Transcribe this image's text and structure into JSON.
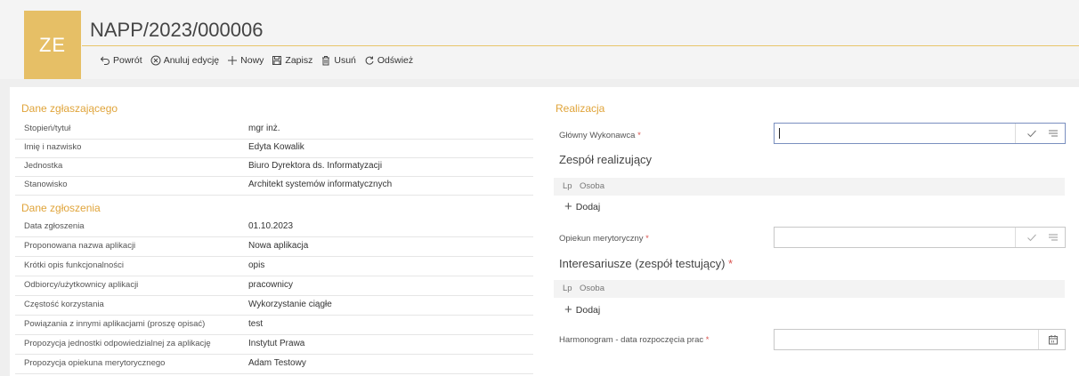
{
  "header": {
    "avatar_initials": "ZE",
    "title": "NAPP/2023/000006"
  },
  "toolbar": {
    "back": "Powrót",
    "cancel_edit": "Anuluj edycję",
    "new": "Nowy",
    "save": "Zapisz",
    "delete": "Usuń",
    "refresh": "Odśwież"
  },
  "left": {
    "section1_title": "Dane zgłaszającego",
    "section1_rows": [
      {
        "label": "Stopień/tytuł",
        "value": "mgr inż."
      },
      {
        "label": "Imię i nazwisko",
        "value": "Edyta Kowalik"
      },
      {
        "label": "Jednostka",
        "value": "Biuro Dyrektora ds. Informatyzacji"
      },
      {
        "label": "Stanowisko",
        "value": "Architekt systemów informatycznych"
      }
    ],
    "section2_title": "Dane zgłoszenia",
    "section2_rows": [
      {
        "label": "Data zgłoszenia",
        "value": "01.10.2023"
      },
      {
        "label": "Proponowana nazwa aplikacji",
        "value": "Nowa aplikacja"
      },
      {
        "label": "Krótki opis funkcjonalności",
        "value": "opis"
      },
      {
        "label": "Odbiorcy/użytkownicy aplikacji",
        "value": "pracownicy"
      },
      {
        "label": "Częstość korzystania",
        "value": "Wykorzystanie ciągłe"
      },
      {
        "label": "Powiązania z innymi aplikacjami (proszę opisać)",
        "value": "test"
      },
      {
        "label": "Propozycja jednostki odpowiedzialnej za aplikację",
        "value": "Instytut Prawa"
      },
      {
        "label": "Propozycja opiekuna merytorycznego",
        "value": "Adam Testowy"
      }
    ]
  },
  "right": {
    "section_title": "Realizacja",
    "main_contractor_label": "Główny Wykonawca",
    "main_contractor_value": "",
    "team_title": "Zespół realizujący",
    "team_col_lp": "Lp",
    "team_col_person": "Osoba",
    "team_add": "Dodaj",
    "supervisor_label": "Opiekun merytoryczny",
    "supervisor_value": "",
    "stakeholders_title": "Interesariusze (zespół testujący)",
    "stakeholders_col_lp": "Lp",
    "stakeholders_col_person": "Osoba",
    "stakeholders_add": "Dodaj",
    "schedule_label": "Harmonogram - data rozpoczęcia prac",
    "schedule_value": "",
    "required_mark": "*"
  },
  "colors": {
    "accent": "#e6bf66",
    "section_heading": "#e0a43a",
    "required": "#d9534f"
  },
  "icons": [
    "back-arrow-icon",
    "cancel-circle-icon",
    "plus-icon",
    "save-disk-icon",
    "trash-icon",
    "refresh-icon",
    "check-icon",
    "list-icon",
    "calendar-icon"
  ]
}
